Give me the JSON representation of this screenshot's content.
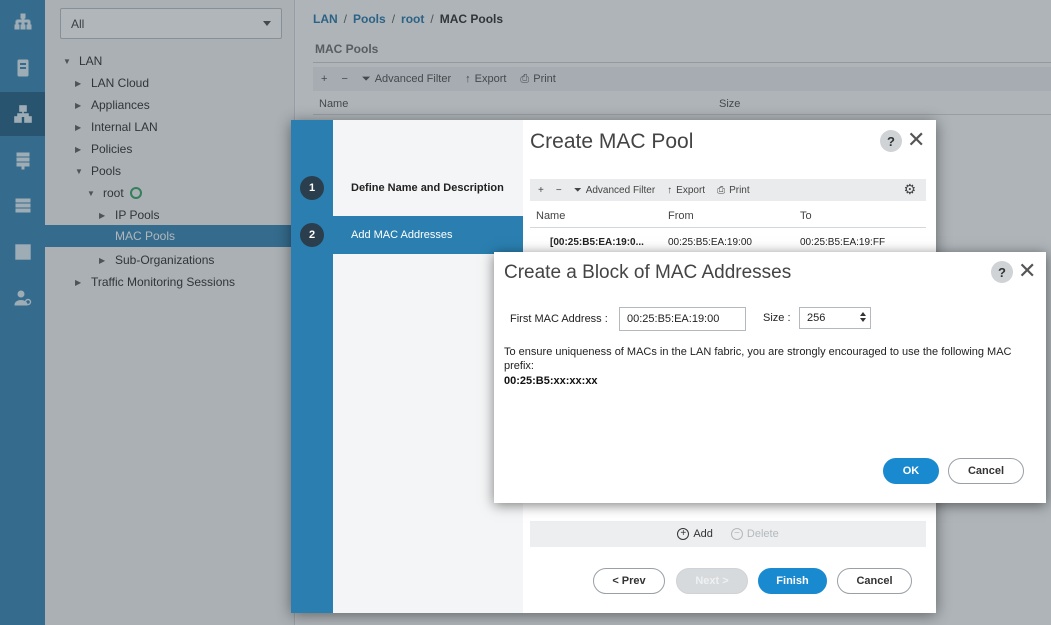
{
  "rail": {
    "icons": [
      "equipment-icon",
      "servers-icon",
      "lan-icon",
      "san-icon",
      "storage-icon",
      "chassis-icon",
      "admin-icon"
    ]
  },
  "nav": {
    "filter_value": "All",
    "tree": [
      {
        "label": "LAN",
        "level": 0,
        "twisty": "down"
      },
      {
        "label": "LAN Cloud",
        "level": 1,
        "twisty": "right"
      },
      {
        "label": "Appliances",
        "level": 1,
        "twisty": "right"
      },
      {
        "label": "Internal LAN",
        "level": 1,
        "twisty": "right"
      },
      {
        "label": "Policies",
        "level": 1,
        "twisty": "right"
      },
      {
        "label": "Pools",
        "level": 1,
        "twisty": "down"
      },
      {
        "label": "root",
        "level": 2,
        "twisty": "down"
      },
      {
        "label": "IP Pools",
        "level": 3,
        "twisty": "right"
      },
      {
        "label": "MAC Pools",
        "level": 3,
        "twisty": "",
        "selected": true
      },
      {
        "label": "Sub-Organizations",
        "level": 3,
        "twisty": "right"
      },
      {
        "label": "Traffic Monitoring Sessions",
        "level": 1,
        "twisty": "right"
      }
    ]
  },
  "main": {
    "breadcrumb": [
      "LAN",
      "Pools",
      "root",
      "MAC Pools"
    ],
    "section_title": "MAC Pools",
    "toolbar": {
      "add": "+",
      "remove": "−",
      "filter": "Advanced Filter",
      "export": "Export",
      "print": "Print"
    },
    "columns": {
      "name": "Name",
      "size": "Size"
    }
  },
  "wizard": {
    "title": "Create MAC Pool",
    "help": "?",
    "close": "✕",
    "steps": [
      {
        "num": "1",
        "label": "Define Name and Description",
        "active": false
      },
      {
        "num": "2",
        "label": "Add MAC Addresses",
        "active": true
      }
    ],
    "toolbar": {
      "add": "+",
      "remove": "−",
      "filter": "Advanced Filter",
      "export": "Export",
      "print": "Print"
    },
    "columns": {
      "name": "Name",
      "from": "From",
      "to": "To"
    },
    "rows": [
      {
        "name": "[00:25:B5:EA:19:0...",
        "from": "00:25:B5:EA:19:00",
        "to": "00:25:B5:EA:19:FF"
      }
    ],
    "add_label": "Add",
    "delete_label": "Delete",
    "buttons": {
      "prev": "< Prev",
      "next": "Next >",
      "finish": "Finish",
      "cancel": "Cancel"
    }
  },
  "block_dialog": {
    "title": "Create a Block of MAC Addresses",
    "help": "?",
    "close": "✕",
    "first_mac_label": "First MAC Address :",
    "first_mac_value": "00:25:B5:EA:19:00",
    "size_label": "Size :",
    "size_value": "256",
    "message": "To ensure uniqueness of MACs in the LAN fabric, you are strongly encouraged to use the following MAC prefix:",
    "prefix": "00:25:B5:xx:xx:xx",
    "ok": "OK",
    "cancel": "Cancel"
  }
}
